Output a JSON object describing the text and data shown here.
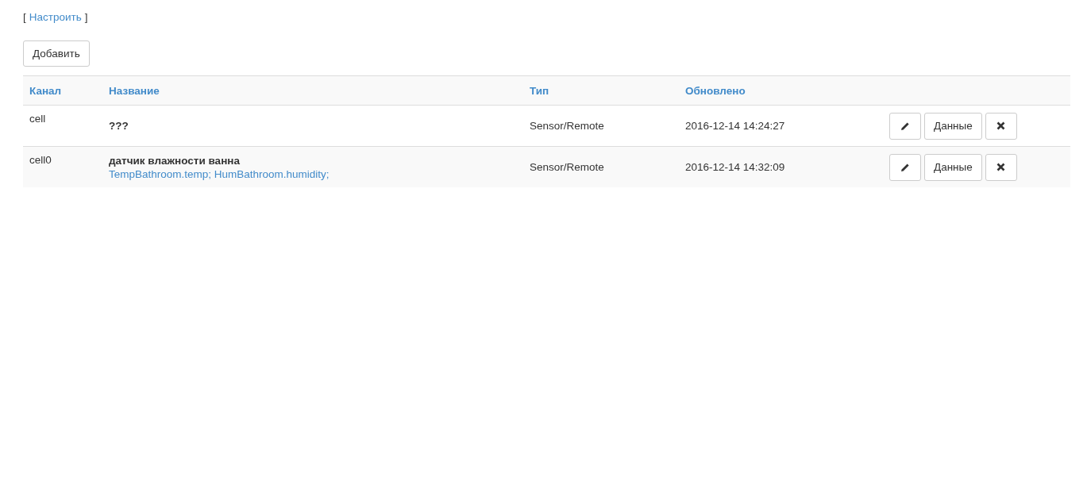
{
  "configure_link": {
    "open": "[",
    "label": "Настроить",
    "close": "]"
  },
  "add_button": "Добавить",
  "table": {
    "columns": [
      "Канал",
      "Название",
      "Тип",
      "Обновлено"
    ],
    "rows": [
      {
        "channel": "cell",
        "name": "???",
        "type": "Sensor/Remote",
        "updated": "2016-12-14 14:24:27",
        "data_button": "Данные"
      },
      {
        "channel": "cell0",
        "name": "датчик влажности ванна",
        "links": "TempBathroom.temp; HumBathroom.humidity;",
        "type": "Sensor/Remote",
        "updated": "2016-12-14 14:32:09",
        "data_button": "Данные"
      }
    ]
  }
}
